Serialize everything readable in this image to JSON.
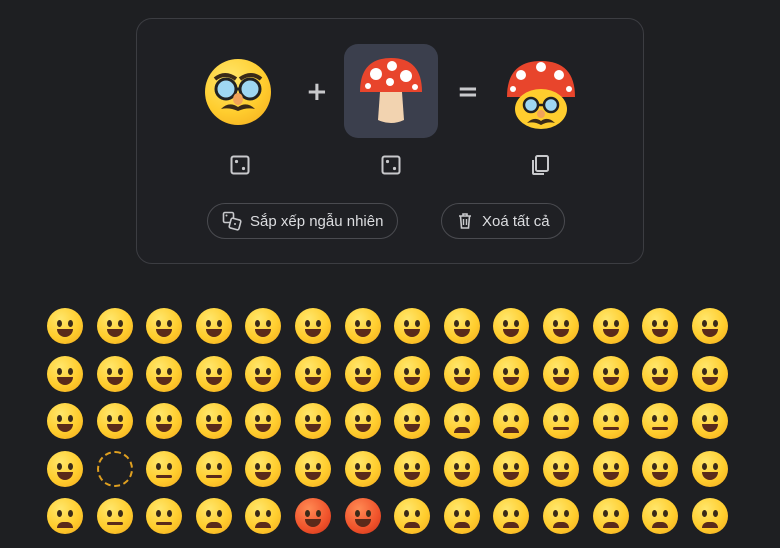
{
  "mixer": {
    "plus": "+",
    "equals": "=",
    "left_emoji": "🥸",
    "right_emoji": "🍄",
    "result_emoji": "🍄",
    "shuffle_label": "Sắp xếp ngẫu nhiên",
    "clear_label": "Xoá tất cả"
  },
  "emoji_grid": [
    [
      "😀",
      "😃",
      "😄",
      "😁",
      "😆",
      "😅",
      "😂",
      "🤣",
      "😭",
      "😉",
      "😗",
      "😙",
      "😚",
      "😘"
    ],
    [
      "🥰",
      "😍",
      "🤩",
      "🥳",
      "🫠",
      "🙃",
      "🙂",
      "🥲",
      "🥹",
      "😊",
      "☺️",
      "😌",
      "😏",
      "😴"
    ],
    [
      "😪",
      "🤤",
      "😋",
      "😛",
      "😝",
      "😜",
      "🤪",
      "🥴",
      "😔",
      "🥺",
      "😬",
      "😑",
      "😐",
      "😶"
    ],
    [
      "🤯",
      "🫥",
      "🤐",
      "🫡",
      "🤔",
      "🤫",
      "🫢",
      "🤭",
      "🥱",
      "🤗",
      "🫣",
      "😱",
      "🤨",
      "🧐"
    ],
    [
      "😒",
      "🙄",
      "😮‍💨",
      "😤",
      "😠",
      "😡",
      "🤬",
      "😞",
      "😓",
      "😟",
      "😥",
      "😢",
      "☹️",
      "🙁"
    ]
  ],
  "colors": {
    "background": "#1e1f22",
    "panel_border": "#3c3d42",
    "tile": "#3b3f4d",
    "text": "#dcdde0"
  }
}
